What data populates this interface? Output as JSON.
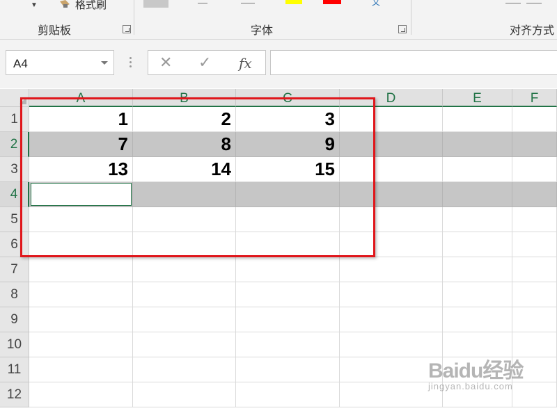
{
  "ribbon": {
    "format_painter_label": "格式刷",
    "groups": [
      {
        "label": "剪贴板"
      },
      {
        "label": "字体"
      },
      {
        "label": "对齐方式"
      }
    ]
  },
  "formula_bar": {
    "name_box": "A4",
    "cancel_symbol": "✕",
    "enter_symbol": "✓",
    "fx_symbol": "fx",
    "formula_value": ""
  },
  "sheet": {
    "columns": [
      "A",
      "B",
      "C",
      "D",
      "E",
      "F"
    ],
    "rows": [
      "1",
      "2",
      "3",
      "4",
      "5",
      "6",
      "7",
      "8",
      "9",
      "10",
      "11",
      "12"
    ],
    "selected_row": "4",
    "shaded_rows": [
      "2",
      "4"
    ],
    "cells": {
      "A1": "1",
      "B1": "2",
      "C1": "3",
      "A2": "7",
      "B2": "8",
      "C2": "9",
      "A3": "13",
      "B3": "14",
      "C3": "15"
    }
  },
  "colors": {
    "highlight_border": "#e0161b",
    "excel_green": "#217346",
    "row_shade": "#c6c6c6"
  },
  "watermark": {
    "brand": "Baidu经验",
    "url": "jingyan.baidu.com"
  }
}
